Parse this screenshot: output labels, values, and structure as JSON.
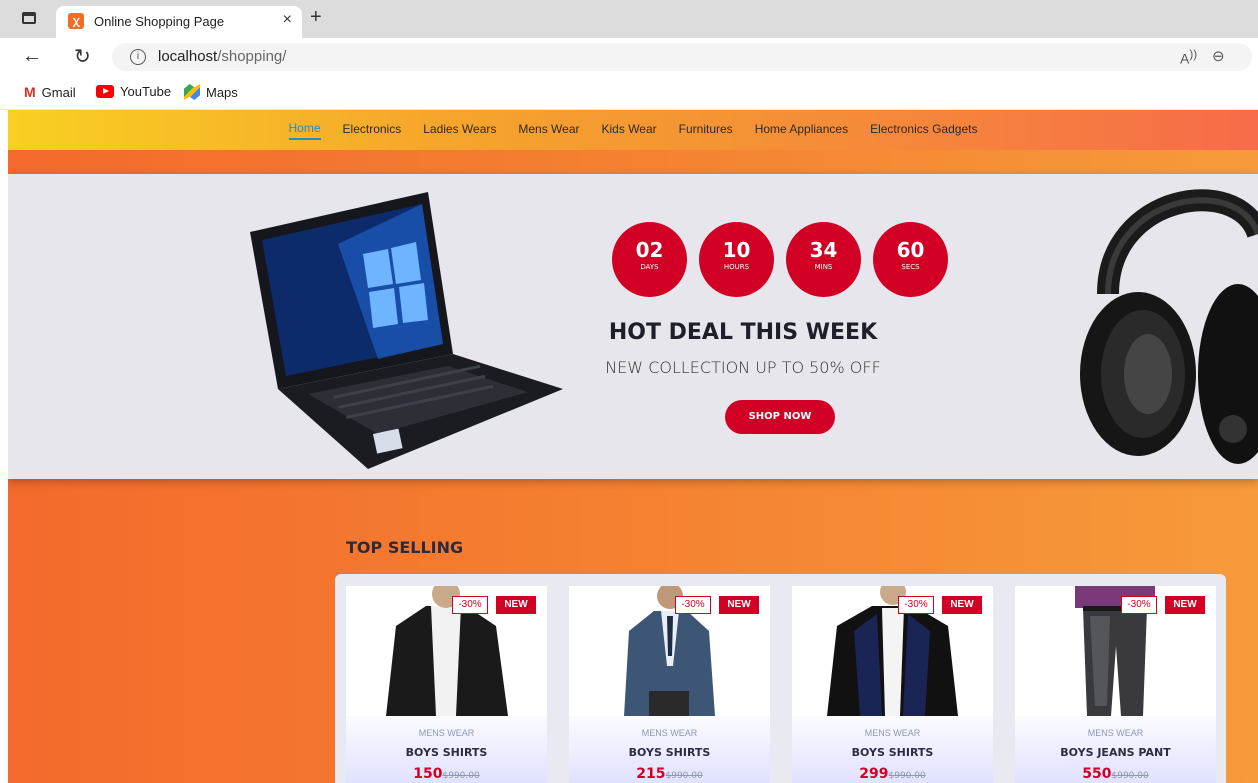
{
  "browser": {
    "tab_title": "Online Shopping Page",
    "tab_close": "×",
    "new_tab": "+",
    "url_host": "localhost",
    "url_path": "/shopping/",
    "bookmarks": [
      "Gmail",
      "YouTube",
      "Maps"
    ]
  },
  "nav": {
    "items": [
      "Home",
      "Electronics",
      "Ladies Wears",
      "Mens Wear",
      "Kids Wear",
      "Furnitures",
      "Home Appliances",
      "Electronics Gadgets"
    ],
    "active": "Home"
  },
  "hero": {
    "countdown": [
      {
        "value": "02",
        "unit": "DAYS"
      },
      {
        "value": "10",
        "unit": "HOURS"
      },
      {
        "value": "34",
        "unit": "MINS"
      },
      {
        "value": "60",
        "unit": "SECS"
      }
    ],
    "title": "HOT DEAL THIS WEEK",
    "subtitle": "NEW COLLECTION UP TO 50% OFF",
    "cta": "SHOP NOW"
  },
  "top_selling": {
    "title": "TOP SELLING",
    "products": [
      {
        "category": "MENS WEAR",
        "name": "BOYS SHIRTS",
        "price": "150",
        "old_price": "$990.00",
        "discount": "-30%",
        "badge": "NEW"
      },
      {
        "category": "MENS WEAR",
        "name": "BOYS SHIRTS",
        "price": "215",
        "old_price": "$990.00",
        "discount": "-30%",
        "badge": "NEW"
      },
      {
        "category": "MENS WEAR",
        "name": "BOYS SHIRTS",
        "price": "299",
        "old_price": "$990.00",
        "discount": "-30%",
        "badge": "NEW"
      },
      {
        "category": "MENS WEAR",
        "name": "BOYS JEANS PANT",
        "price": "550",
        "old_price": "$990.00",
        "discount": "-30%",
        "badge": "NEW"
      }
    ]
  },
  "colors": {
    "accent": "#d10024",
    "page_bg": "#f36a2c",
    "hero_bg": "#e6e6ec"
  }
}
